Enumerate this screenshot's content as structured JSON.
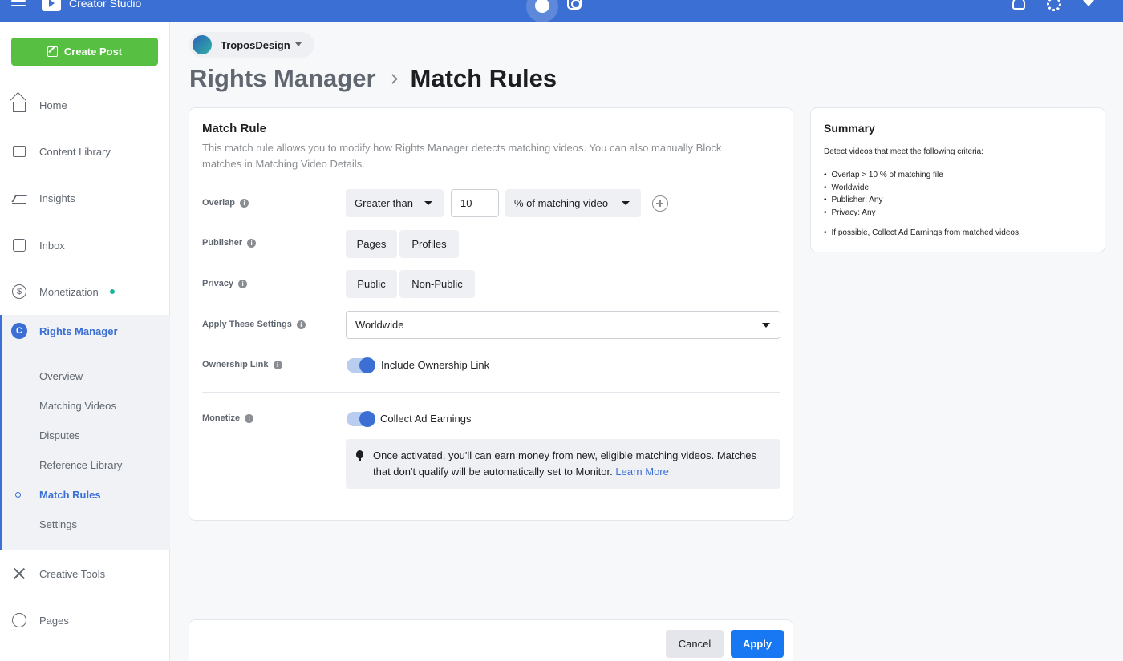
{
  "app": {
    "title": "Creator Studio"
  },
  "colors": {
    "accent": "#3b6fd4",
    "create": "#57c043",
    "apply": "#1877f2",
    "status_dot": "#18b69b"
  },
  "icons": {
    "menu": "hamburger-icon",
    "facebook": "facebook-icon",
    "instagram": "instagram-icon",
    "bell": "bell-icon",
    "settings": "gear-icon"
  },
  "sidebar": {
    "create_label": "Create Post",
    "items": [
      {
        "label": "Home",
        "icon": "home-icon"
      },
      {
        "label": "Content Library",
        "icon": "library-icon"
      },
      {
        "label": "Insights",
        "icon": "insights-icon"
      },
      {
        "label": "Inbox",
        "icon": "inbox-icon"
      },
      {
        "label": "Monetization",
        "icon": "dollar-icon"
      }
    ],
    "rights_manager": {
      "label": "Rights Manager",
      "subitems": [
        "Overview",
        "Matching Videos",
        "Disputes",
        "Reference Library",
        "Match Rules",
        "Settings"
      ],
      "active": "Match Rules"
    },
    "bottom_items": [
      {
        "label": "Creative Tools",
        "icon": "tools-icon"
      },
      {
        "label": "Pages",
        "icon": "pages-icon"
      }
    ]
  },
  "page_selector": {
    "name": "TroposDesign"
  },
  "breadcrumb": {
    "parent": "Rights Manager",
    "current": "Match Rules"
  },
  "match_rule": {
    "title": "Match Rule",
    "description": "This match rule allows you to modify how Rights Manager detects matching videos. You can also manually Block matches in Matching Video Details.",
    "overlap": {
      "label": "Overlap",
      "comparator": "Greater than",
      "value": "10",
      "unit": "% of matching video"
    },
    "publisher": {
      "label": "Publisher",
      "options": [
        "Pages",
        "Profiles"
      ]
    },
    "privacy": {
      "label": "Privacy",
      "options": [
        "Public",
        "Non-Public"
      ]
    },
    "apply_settings": {
      "label": "Apply These Settings",
      "value": "Worldwide"
    },
    "ownership": {
      "label": "Ownership Link",
      "toggle_label": "Include Ownership Link",
      "on": true
    },
    "monetize": {
      "label": "Monetize",
      "toggle_label": "Collect Ad Earnings",
      "on": true
    },
    "notice": {
      "text": "Once activated, you'll can earn money from new, eligible matching videos. Matches that don't qualify will be automatically set to Monitor.",
      "link": "Learn More"
    }
  },
  "summary": {
    "title": "Summary",
    "intro": "Detect videos that meet the following criteria:",
    "criteria": [
      "Overlap > 10 % of matching file",
      "Worldwide",
      "Publisher: Any",
      "Privacy: Any"
    ],
    "footer": "If possible, Collect Ad Earnings from matched videos."
  },
  "actions": {
    "cancel": "Cancel",
    "apply": "Apply"
  }
}
